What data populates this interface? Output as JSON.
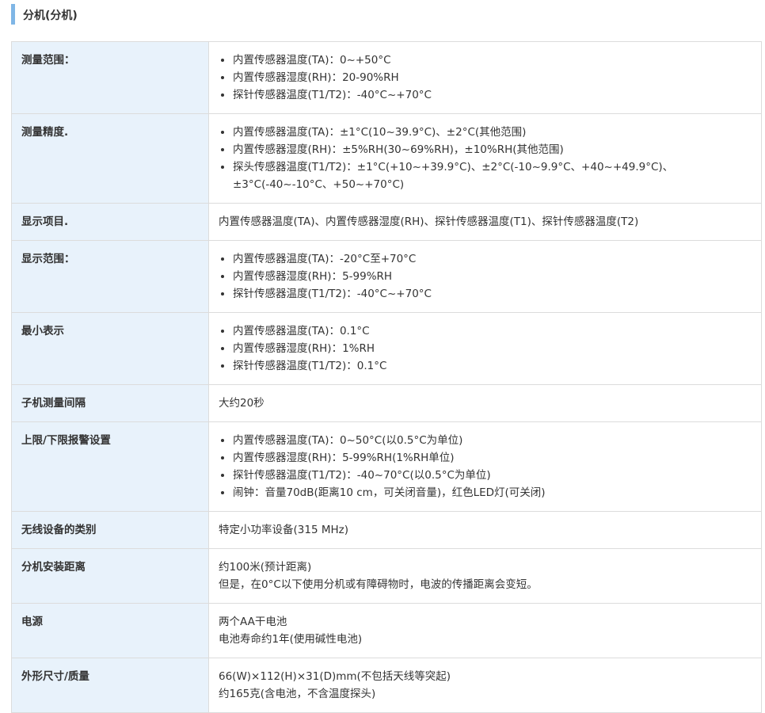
{
  "section": {
    "title": "分机(分机)"
  },
  "rows": [
    {
      "label": "测量范围：",
      "items": [
        "内置传感器温度(TA)：0~+50°C",
        "内置传感器湿度(RH)：20-90%RH",
        "探针传感器温度(T1/T2)：-40°C~+70°C"
      ]
    },
    {
      "label": "测量精度.",
      "items": [
        "内置传感器温度(TA)：±1°C(10~39.9°C)、±2°C(其他范围)",
        "内置传感器湿度(RH)：±5%RH(30~69%RH)，±10%RH(其他范围)",
        "探头传感器温度(T1/T2)：±1°C(+10~+39.9°C)、±2°C(-10~9.9°C、+40~+49.9°C)、±3°C(-40~-10°C、+50~+70°C)"
      ]
    },
    {
      "label": "显示项目.",
      "lines": [
        "内置传感器温度(TA)、内置传感器湿度(RH)、探针传感器温度(T1)、探针传感器温度(T2)"
      ]
    },
    {
      "label": "显示范围：",
      "items": [
        "内置传感器温度(TA)：-20°C至+70°C",
        "内置传感器湿度(RH)：5-99%RH",
        "探针传感器温度(T1/T2)：-40°C~+70°C"
      ]
    },
    {
      "label": "最小表示",
      "items": [
        "内置传感器温度(TA)：0.1°C",
        "内置传感器湿度(RH)：1%RH",
        "探针传感器温度(T1/T2)：0.1°C"
      ]
    },
    {
      "label": "子机测量间隔",
      "lines": [
        "大约20秒"
      ]
    },
    {
      "label": "上限/下限报警设置",
      "items": [
        "内置传感器温度(TA)：0~50°C(以0.5°C为单位)",
        "内置传感器湿度(RH)：5-99%RH(1%RH单位)",
        "探针传感器温度(T1/T2)：-40~70°C(以0.5°C为单位)",
        "闹钟：音量70dB(距离10 cm，可关闭音量)，红色LED灯(可关闭)"
      ]
    },
    {
      "label": "无线设备的类别",
      "lines": [
        "特定小功率设备(315 MHz)"
      ]
    },
    {
      "label": "分机安装距离",
      "lines": [
        "约100米(预计距离)",
        "但是，在0°C以下使用分机或有障碍物时，电波的传播距离会变短。"
      ]
    },
    {
      "label": "电源",
      "lines": [
        "两个AA干电池",
        "电池寿命约1年(使用碱性电池)"
      ]
    },
    {
      "label": "外形尺寸/质量",
      "lines": [
        "66(W)×112(H)×31(D)mm(不包括天线等突起)",
        "约165克(含电池，不含温度探头)"
      ]
    }
  ]
}
